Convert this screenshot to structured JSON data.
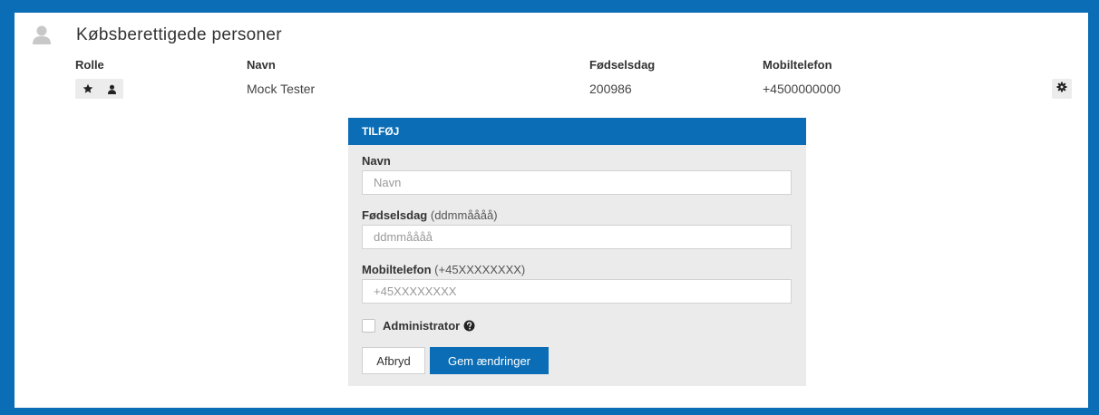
{
  "section": {
    "title": "Købsberettigede personer",
    "icon": "user-icon"
  },
  "table": {
    "headers": {
      "role": "Rolle",
      "name": "Navn",
      "birthday": "Fødselsdag",
      "mobile": "Mobiltelefon"
    },
    "rows": [
      {
        "role_icons": [
          "star-icon",
          "user-icon"
        ],
        "name": "Mock Tester",
        "birthday": "200986",
        "mobile": "+4500000000",
        "action_icon": "gear-icon"
      }
    ]
  },
  "add_form": {
    "title": "TILFØJ",
    "name_label": "Navn",
    "name_placeholder": "Navn",
    "name_value": "",
    "birthday_label": "Fødselsdag",
    "birthday_hint": "(ddmmåååå)",
    "birthday_placeholder": "ddmmåååå",
    "birthday_value": "",
    "mobile_label": "Mobiltelefon",
    "mobile_hint": "(+45XXXXXXXX)",
    "mobile_placeholder": "+45XXXXXXXX",
    "mobile_value": "",
    "admin_label": "Administrator",
    "admin_checked": false,
    "admin_help_icon": "question-circle-icon",
    "cancel_label": "Afbryd",
    "save_label": "Gem ændringer"
  },
  "colors": {
    "brand_blue": "#0a6db5",
    "form_background": "#ebebeb",
    "icon_grey": "#c8c8c8"
  }
}
